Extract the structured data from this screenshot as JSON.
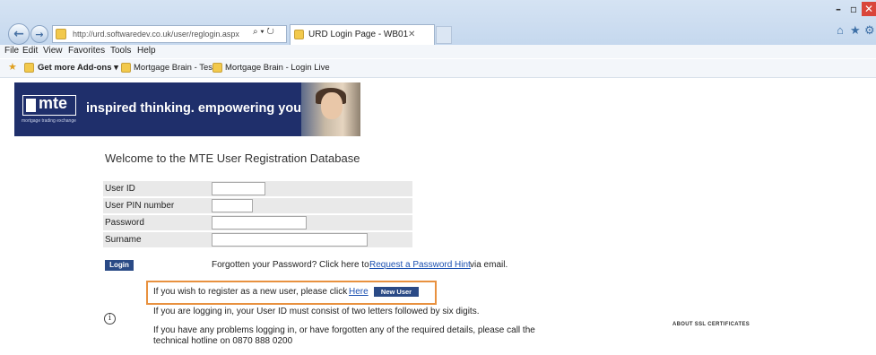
{
  "browser": {
    "window_controls": {
      "minimize": "–",
      "maximize": "▫",
      "close": "✕"
    },
    "back_icon": "←",
    "forward_icon": "→",
    "address_url": "http://urd.softwaredev.co.uk/user/reglogin.aspx",
    "address_tools": "⌕ ▾ ↻",
    "tab_title": "URD Login Page - WB01",
    "tab_close": "✕",
    "right_icons": {
      "home": "⌂",
      "star": "★",
      "gear": "⚙"
    },
    "menu": [
      "File",
      "Edit",
      "View",
      "Favorites",
      "Tools",
      "Help"
    ],
    "favorites": {
      "add_ons": "Get more Add-ons ▾",
      "items": [
        "Mortgage Brain - Test",
        "Mortgage Brain - Login Live"
      ]
    }
  },
  "banner": {
    "logo": "mte",
    "logo_sub": "mortgage trading exchange",
    "tagline": "inspired thinking. empowering you."
  },
  "page": {
    "welcome": "Welcome to the MTE User Registration Database",
    "fields": [
      {
        "label": "User ID",
        "value": ""
      },
      {
        "label": "User PIN number",
        "value": ""
      },
      {
        "label": "Password",
        "value": ""
      },
      {
        "label": "Surname",
        "value": ""
      }
    ],
    "login_button": "Login",
    "forgot_text": "Forgotten your Password? Click here to",
    "forgot_link": "Request a Password Hint",
    "forgot_tail": "via email.",
    "register_text": "If you wish to register as a new user, please click",
    "register_link": "Here",
    "new_user_button": "New User",
    "info_icon": "i",
    "note_userid": "If you are logging in, your User ID must consist of two letters followed by six digits.",
    "note_help": "If you have any problems logging in, or have forgotten any of the required details, please call the technical hotline on 0870 888 0200",
    "ssl_link": "ABOUT SSL CERTIFICATES"
  },
  "colors": {
    "banner_bg": "#1f2f6b",
    "button_bg": "#2a4a86",
    "link": "#1a4fb0",
    "highlight_border": "#e8913f"
  }
}
